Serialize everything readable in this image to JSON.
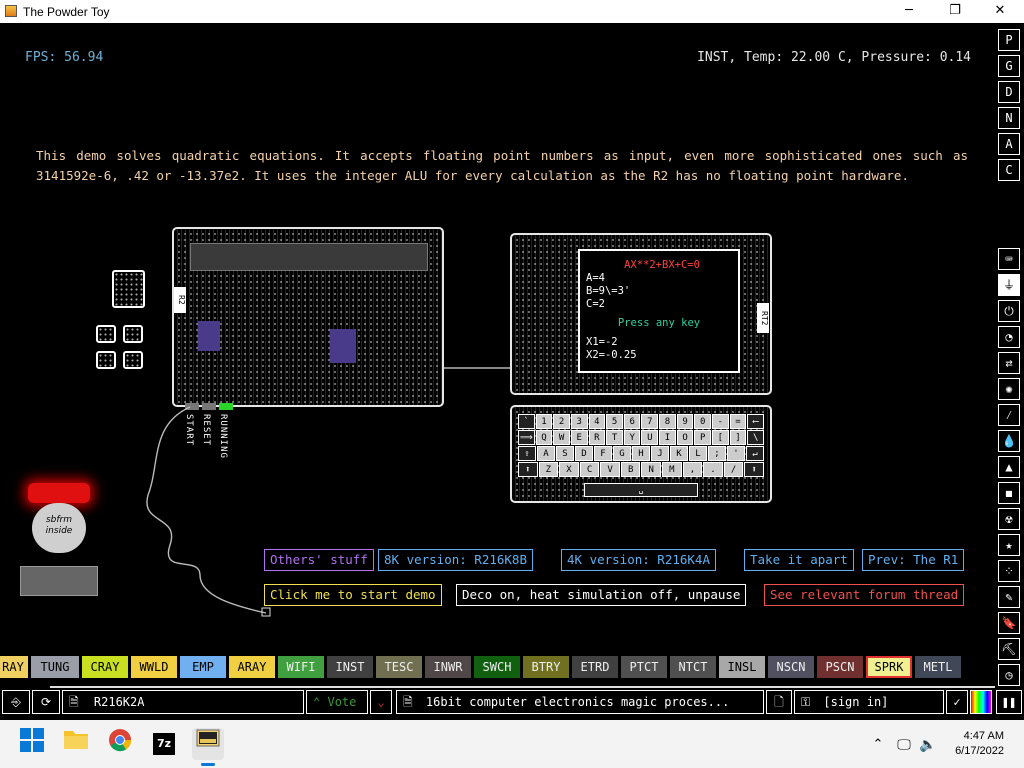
{
  "window": {
    "title": "The Powder Toy",
    "minimize": "─",
    "maximize": "❐",
    "close": "✕"
  },
  "hud": {
    "fps": "FPS: 56.94",
    "status": "INST, Temp: 22.00 C, Pressure: 0.14"
  },
  "description": "This demo solves quadratic equations. It accepts floating point numbers as input, even more sophisticated ones such as 3141592e-6, .42 or -13.37e2. It uses the integer ALU for every calculation as the R2 has no floating point hardware.",
  "board": {
    "label": "R2",
    "start": "START",
    "reset": "RESET",
    "running": "RUNNING",
    "screen_tag": "RT2",
    "screen_lines": [
      "AX**2+BX+C=0",
      "A=4",
      "B=9\\=3'",
      "C=2",
      "Press any key",
      "X1=-2",
      "X2=-0.25"
    ],
    "badge_text": "sbfrm inside",
    "keyboard_rows": [
      [
        "`",
        "1",
        "2",
        "3",
        "4",
        "5",
        "6",
        "7",
        "8",
        "9",
        "0",
        "-",
        "=",
        "⟵"
      ],
      [
        "⟹",
        "Q",
        "W",
        "E",
        "R",
        "T",
        "Y",
        "U",
        "I",
        "O",
        "P",
        "[",
        "]",
        "\\"
      ],
      [
        "⇪",
        "A",
        "S",
        "D",
        "F",
        "G",
        "H",
        "J",
        "K",
        "L",
        ";",
        "'",
        "↵"
      ],
      [
        "⬆",
        "Z",
        "X",
        "C",
        "V",
        "B",
        "N",
        "M",
        ",",
        ".",
        "/",
        "⬆"
      ]
    ],
    "spacebar": "␣"
  },
  "buttons": {
    "others": "Others' stuff",
    "v8k": "8K version: R216K8B",
    "v4k": "4K version: R216K4A",
    "apart": "Take it apart",
    "prev": "Prev: The R1",
    "start_demo": "Click me to start demo",
    "deco": "Deco on, heat simulation off, unpause",
    "forum": "See relevant forum thread"
  },
  "elements": [
    {
      "name": "RAY",
      "color": "#f0d060"
    },
    {
      "name": "TUNG",
      "color": "#9a9ea8"
    },
    {
      "name": "CRAY",
      "color": "#c8e020"
    },
    {
      "name": "WWLD",
      "color": "#f0d040"
    },
    {
      "name": "EMP",
      "color": "#70b0f0"
    },
    {
      "name": "ARAY",
      "color": "#f0d040"
    },
    {
      "name": "WIFI",
      "color": "#40a040"
    },
    {
      "name": "INST",
      "color": "#404040"
    },
    {
      "name": "TESC",
      "color": "#707050"
    },
    {
      "name": "INWR",
      "color": "#504848"
    },
    {
      "name": "SWCH",
      "color": "#106010"
    },
    {
      "name": "BTRY",
      "color": "#707020"
    },
    {
      "name": "ETRD",
      "color": "#404040"
    },
    {
      "name": "PTCT",
      "color": "#505050"
    },
    {
      "name": "NTCT",
      "color": "#505050"
    },
    {
      "name": "INSL",
      "color": "#a8a8a8"
    },
    {
      "name": "NSCN",
      "color": "#505060"
    },
    {
      "name": "PSCN",
      "color": "#703030"
    },
    {
      "name": "SPRK",
      "color": "#f0f090"
    },
    {
      "name": "METL",
      "color": "#404858"
    }
  ],
  "bottombar": {
    "save_name": "R216K2A",
    "vote": "Vote",
    "save_desc": "16bit computer electronics magic proces...",
    "sign_in": "[sign in]"
  },
  "rightbar": {
    "menu": [
      "P",
      "G",
      "D",
      "N",
      "A",
      "C"
    ]
  },
  "taskbar": {
    "time": "4:47 AM",
    "date": "6/17/2022",
    "zip_label": "7z"
  }
}
